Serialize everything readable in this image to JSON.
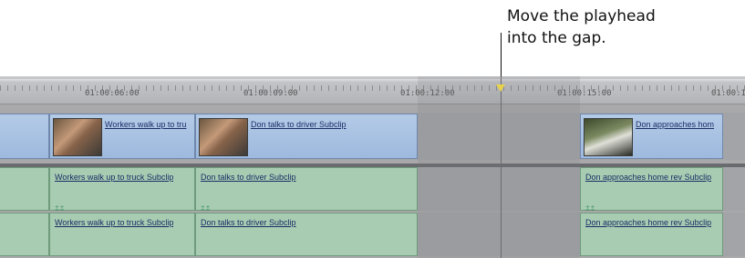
{
  "callout": {
    "line1": "Move the playhead",
    "line2": "into the gap."
  },
  "ruler": {
    "ticks": [
      "01:00:06:00",
      "01:00:09:00",
      "01:00:12:00",
      "01:00:15:00",
      "01:00:1"
    ]
  },
  "video_clips": [
    {
      "title": "Workers walk up to tru",
      "thumb": "workers-thumbnail"
    },
    {
      "title": "Don talks to driver Subclip",
      "thumb": "don-thumbnail"
    },
    {
      "title": "Don approaches hom",
      "thumb": "house-thumbnail"
    }
  ],
  "audio_track_1": [
    "Workers walk up to truck Subclip",
    "Don talks to driver Subclip",
    "Don approaches home rev Subclip"
  ],
  "audio_track_2": [
    "Workers walk up to truck Subclip",
    "Don talks to driver Subclip",
    "Don approaches home rev Subclip"
  ],
  "link_marker_glyph": "⩲⩲",
  "colors": {
    "video_clip": "#a9c3e4",
    "audio_clip": "#a7ccb1",
    "playhead": "#e6d34b"
  }
}
